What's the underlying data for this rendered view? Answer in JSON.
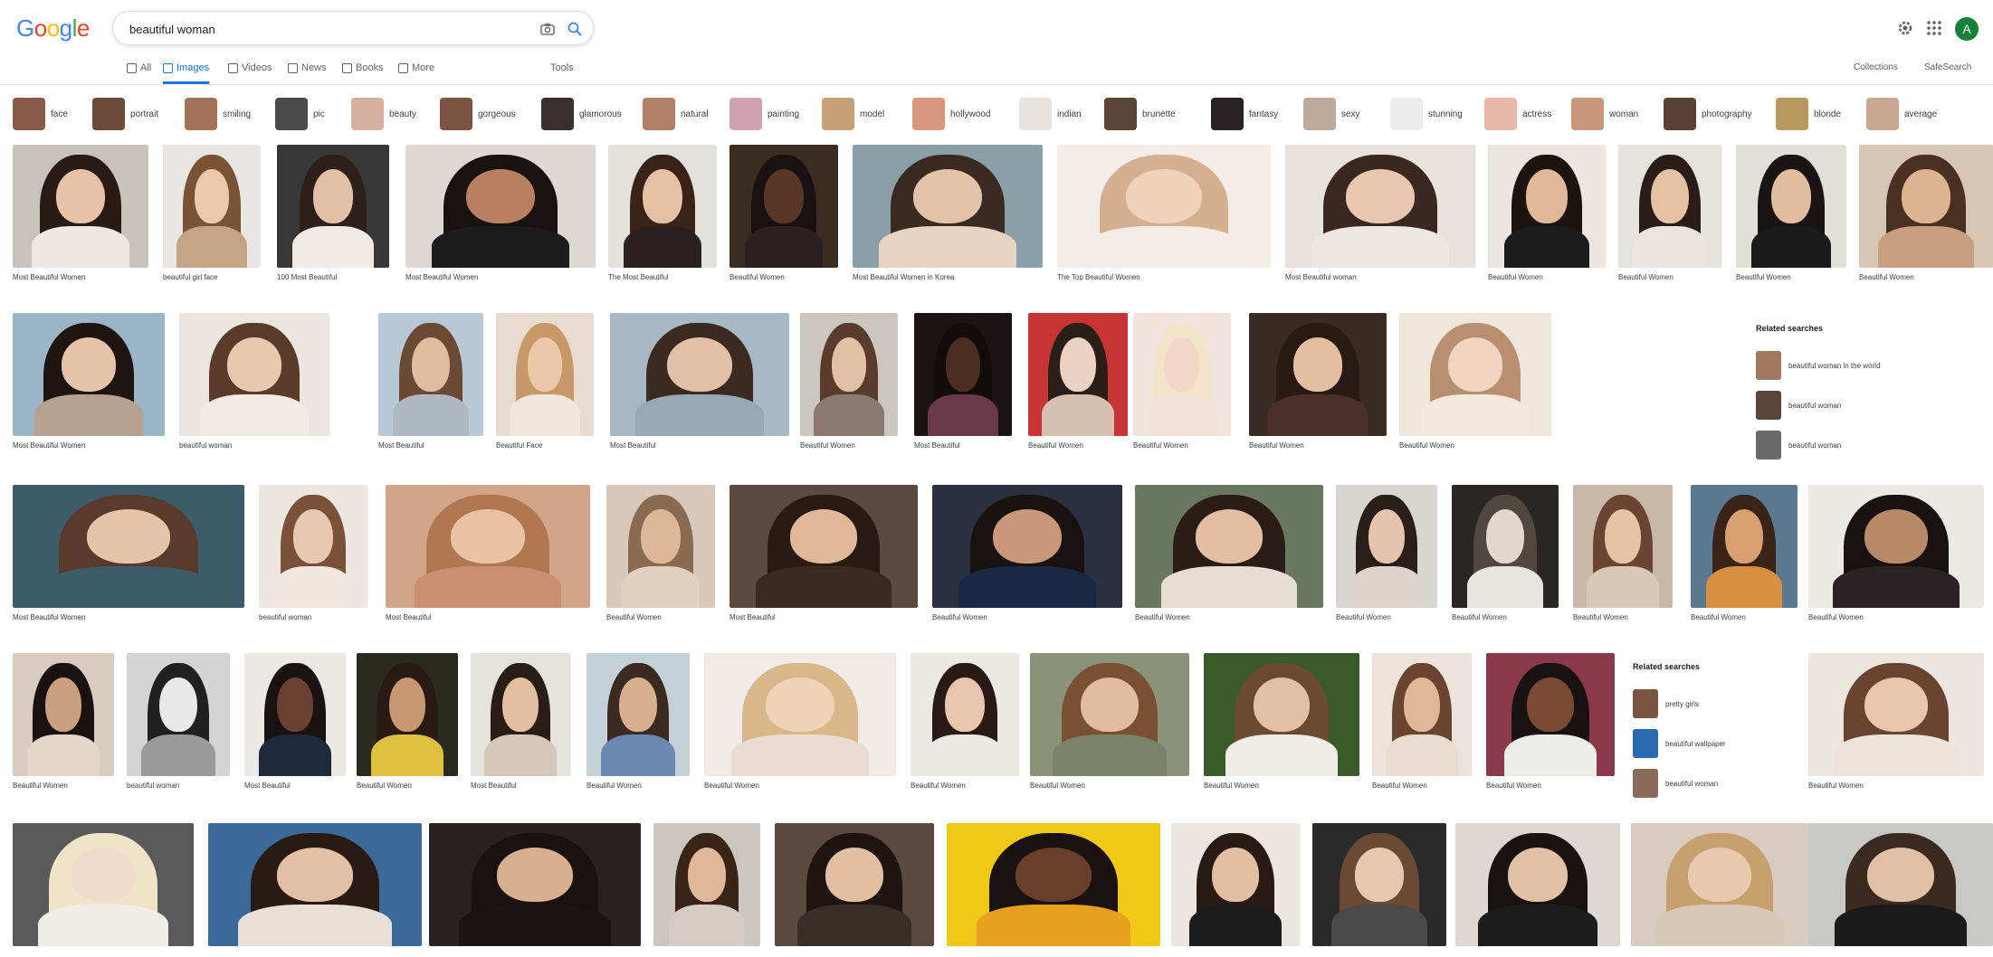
{
  "header": {
    "logo": [
      "G",
      "o",
      "o",
      "g",
      "l",
      "e"
    ],
    "search_value": "beautiful woman",
    "search_placeholder": "Search",
    "avatar_letter": "A",
    "icons": [
      "camera-icon",
      "search-icon",
      "settings-icon",
      "apps-icon"
    ]
  },
  "tabs": [
    {
      "label": "All",
      "icon": "search-icon",
      "active": false
    },
    {
      "label": "Images",
      "icon": "image-icon",
      "active": true
    },
    {
      "label": "Videos",
      "icon": "video-icon",
      "active": false
    },
    {
      "label": "News",
      "icon": "news-icon",
      "active": false
    },
    {
      "label": "Books",
      "icon": "book-icon",
      "active": false
    },
    {
      "label": "More",
      "icon": "more-icon",
      "active": false
    }
  ],
  "tools_label": "Tools",
  "right_links": {
    "collections": "Collections",
    "safesearch": "SafeSearch"
  },
  "chips": [
    {
      "label": "face",
      "color": "#8a5a48"
    },
    {
      "label": "portrait",
      "color": "#6b4a3a"
    },
    {
      "label": "smiling",
      "color": "#a27258"
    },
    {
      "label": "pic",
      "color": "#4a4a4a"
    },
    {
      "label": "beauty",
      "color": "#d8b0a0"
    },
    {
      "label": "gorgeous",
      "color": "#7a5440"
    },
    {
      "label": "glamorous",
      "color": "#3a3030"
    },
    {
      "label": "natural",
      "color": "#b08068"
    },
    {
      "label": "painting",
      "color": "#d2a0b0"
    },
    {
      "label": "model",
      "color": "#c8a078"
    },
    {
      "label": "hollywood",
      "color": "#d89880"
    },
    {
      "label": "indian",
      "color": "#e8e2dc"
    },
    {
      "label": "brunette",
      "color": "#5a4438"
    },
    {
      "label": "fantasy",
      "color": "#2a2224"
    },
    {
      "label": "sexy",
      "color": "#c0a898"
    },
    {
      "label": "stunning",
      "color": "#ececec"
    },
    {
      "label": "actress",
      "color": "#e8b8a8"
    },
    {
      "label": "woman",
      "color": "#c89878"
    },
    {
      "label": "photography",
      "color": "#5a4036"
    },
    {
      "label": "blonde",
      "color": "#b89860"
    },
    {
      "label": "average",
      "color": "#c8a890"
    }
  ],
  "rows": [
    [
      {
        "title": "Most Beautiful Women",
        "source": "",
        "bg": "#c8c2bc",
        "skin": "#e6c2a8",
        "hair": "#2a1a14",
        "cloth": "#efe8e2"
      },
      {
        "title": "beautiful girl face",
        "source": "",
        "bg": "#e8e6e2",
        "skin": "#ecc8ac",
        "hair": "#7a5234",
        "cloth": "#c4a484"
      },
      {
        "title": "100 Most Beautiful",
        "source": "",
        "bg": "#383838",
        "skin": "#e2c0a6",
        "hair": "#2e2018",
        "cloth": "#f0eae4"
      },
      {
        "title": "Most Beautiful Women",
        "source": "",
        "bg": "#ded8d2",
        "skin": "#b88060",
        "hair": "#1a1210",
        "cloth": "#1c1c1c"
      },
      {
        "title": "The Most Beautiful",
        "source": "",
        "bg": "#e4e0dc",
        "skin": "#e4c0a4",
        "hair": "#3a2218",
        "cloth": "#2a2020"
      },
      {
        "title": "Beautiful Women",
        "source": "",
        "bg": "#3a2c20",
        "skin": "#5a3626",
        "hair": "#1a1210",
        "cloth": "#2a2020"
      },
      {
        "title": "Most Beautiful Women in Korea",
        "source": "",
        "bg": "#8aa0a8",
        "skin": "#e2c2a8",
        "hair": "#3a2a22",
        "cloth": "#e8d4c4"
      },
      {
        "title": "The Top Beautiful Women",
        "source": "",
        "bg": "#f4ece6",
        "skin": "#f0d2bc",
        "hair": "#d4b090",
        "cloth": "#f4ece6"
      },
      {
        "title": "Most Beautiful woman",
        "source": "",
        "bg": "#e8e2de",
        "skin": "#e8c6b0",
        "hair": "#3a2820",
        "cloth": "#eee6e0"
      },
      {
        "title": "Beautiful Women",
        "source": "",
        "bg": "#ece6e2",
        "skin": "#e0b898",
        "hair": "#1c1410",
        "cloth": "#1c1c1c"
      },
      {
        "title": "Beautiful Women",
        "source": "",
        "bg": "#e6e2de",
        "skin": "#e4c0a4",
        "hair": "#2a1c16",
        "cloth": "#ece4de"
      },
      {
        "title": "Beautiful Women",
        "source": "",
        "bg": "#e2ded8",
        "skin": "#e2bca0",
        "hair": "#1a1412",
        "cloth": "#1a1a1a"
      },
      {
        "title": "Beautiful Women",
        "source": "",
        "bg": "#d8c6b4",
        "skin": "#dcb490",
        "hair": "#4a3020",
        "cloth": "#c8a080"
      }
    ],
    [
      {
        "title": "Most Beautiful Women",
        "source": "",
        "bg": "#9ab6c8",
        "skin": "#e6c4aa",
        "hair": "#1e1410",
        "cloth": "#b8a090"
      },
      {
        "title": "beautiful woman",
        "source": "",
        "bg": "#ece6e0",
        "skin": "#e8c8ae",
        "hair": "#5a3a28",
        "cloth": "#f0ebe6"
      },
      {
        "title": "Most Beautiful",
        "source": "",
        "bg": "#b8c8d4",
        "skin": "#e0bca0",
        "hair": "#6a4a34",
        "cloth": "#b0b8c0"
      },
      {
        "title": "Beautiful Face",
        "source": "",
        "bg": "#e8dcd0",
        "skin": "#ecc8aa",
        "hair": "#c89868",
        "cloth": "#f0e6dc"
      },
      {
        "title": "Most Beautiful",
        "source": "",
        "bg": "#a8b8c4",
        "skin": "#e2c0a6",
        "hair": "#3a2a20",
        "cloth": "#98a8b4"
      },
      {
        "title": "Beautiful Women",
        "source": "",
        "bg": "#ccc6c0",
        "skin": "#e2c0a6",
        "hair": "#5a3c2c",
        "cloth": "#8a7a70"
      },
      {
        "title": "Most Beautiful",
        "source": "",
        "bg": "#1a1414",
        "skin": "#4a2e22",
        "hair": "#120c0a",
        "cloth": "#6a3a4a"
      },
      {
        "title": "Beautiful Women",
        "source": "",
        "bg": "#c83434",
        "skin": "#ecd2c0",
        "hair": "#2a1e18",
        "cloth": "#d8c0b0"
      },
      {
        "title": "Beautiful Women",
        "source": "",
        "bg": "#f0e4dc",
        "skin": "#f2d6c6",
        "hair": "#f2e4c8",
        "cloth": "#f0e2d8"
      },
      {
        "title": "Beautiful Women",
        "source": "",
        "bg": "#3a2a24",
        "skin": "#e2bea2",
        "hair": "#2a1a14",
        "cloth": "#4a3028"
      },
      {
        "title": "Beautiful Women",
        "source": "",
        "bg": "#efe6dc",
        "skin": "#f0d4c0",
        "hair": "#b89070",
        "cloth": "#f2e8de"
      }
    ],
    [
      {
        "title": "Most Beautiful Women",
        "source": "",
        "bg": "#3c5c6c",
        "skin": "#e6c4aa",
        "hair": "#5a3a2a",
        "cloth": "#3c5c6c"
      },
      {
        "title": "beautiful woman",
        "source": "",
        "bg": "#ece6e0",
        "skin": "#e8c8b0",
        "hair": "#7a5038",
        "cloth": "#f0e8e0"
      },
      {
        "title": "Most Beautiful",
        "source": "",
        "bg": "#d2a48a",
        "skin": "#eac2a4",
        "hair": "#b07850",
        "cloth": "#c89070"
      },
      {
        "title": "Beautiful Women",
        "source": "",
        "bg": "#d8c8bc",
        "skin": "#dcb898",
        "hair": "#8a6a50",
        "cloth": "#e0d0c0"
      },
      {
        "title": "Most Beautiful",
        "source": "",
        "bg": "#5a4a40",
        "skin": "#e0b898",
        "hair": "#2a1a14",
        "cloth": "#3a2a22"
      },
      {
        "title": "Beautiful Women",
        "source": "",
        "bg": "#2a3040",
        "skin": "#c89878",
        "hair": "#1a1210",
        "cloth": "#1a2844"
      },
      {
        "title": "Beautiful Women",
        "source": "",
        "bg": "#6a7860",
        "skin": "#e2bea2",
        "hair": "#2a1c16",
        "cloth": "#e8ddd4"
      },
      {
        "title": "Beautiful Women",
        "source": "",
        "bg": "#d8d4d0",
        "skin": "#e4c4ac",
        "hair": "#2a1e18",
        "cloth": "#dcd4cc"
      },
      {
        "title": "Beautiful Women",
        "source": "",
        "bg": "#2a2624",
        "skin": "#e0d8d0",
        "hair": "#504840",
        "cloth": "#e8e4e0"
      },
      {
        "title": "Beautiful Women",
        "source": "",
        "bg": "#c8b8a8",
        "skin": "#e6c2a6",
        "hair": "#6a4630",
        "cloth": "#d8c8b8"
      },
      {
        "title": "Beautiful Women",
        "source": "",
        "bg": "#5a7890",
        "skin": "#d8a070",
        "hair": "#3a2418",
        "cloth": "#d89040"
      },
      {
        "title": "Beautiful Women",
        "source": "",
        "bg": "#ece8e4",
        "skin": "#b88a68",
        "hair": "#1a1210",
        "cloth": "#2a2224"
      }
    ],
    [
      {
        "title": "Beautiful Women",
        "source": "",
        "bg": "#d8ccc0",
        "skin": "#caa080",
        "hair": "#1a1210",
        "cloth": "#e4d6c8"
      },
      {
        "title": "beautiful woman",
        "source": "",
        "bg": "#d4d4d4",
        "skin": "#e8e8e8",
        "hair": "#202020",
        "cloth": "#9a9a9a"
      },
      {
        "title": "Most Beautiful",
        "source": "",
        "bg": "#ece8e4",
        "skin": "#6a4030",
        "hair": "#1a1210",
        "cloth": "#1c2a3c"
      },
      {
        "title": "Beautiful Women",
        "source": "",
        "bg": "#2a2a20",
        "skin": "#c89870",
        "hair": "#2a1a14",
        "cloth": "#e0c040"
      },
      {
        "title": "Most Beautiful",
        "source": "",
        "bg": "#e6e2de",
        "skin": "#e2bea2",
        "hair": "#2a1c16",
        "cloth": "#d8c8bc"
      },
      {
        "title": "Beautiful Women",
        "source": "",
        "bg": "#c4d0d8",
        "skin": "#d8b090",
        "hair": "#3a2a20",
        "cloth": "#6a88b0"
      },
      {
        "title": "Beautiful Women",
        "source": "",
        "bg": "#f0ebe6",
        "skin": "#efd2b8",
        "hair": "#d8b888",
        "cloth": "#e8dcd0"
      },
      {
        "title": "Beautiful Women",
        "source": "",
        "bg": "#ece8e4",
        "skin": "#e8c6ae",
        "hair": "#2a1a14",
        "cloth": "#ece8e4"
      },
      {
        "title": "Beautiful Women",
        "source": "",
        "bg": "#8a9278",
        "skin": "#e0bca0",
        "hair": "#7a5034",
        "cloth": "#7a8268"
      },
      {
        "title": "Beautiful Women",
        "source": "",
        "bg": "#3a5a2a",
        "skin": "#e2c0a6",
        "hair": "#6a4a30",
        "cloth": "#f0ece8"
      },
      {
        "title": "Beautiful Women",
        "source": "",
        "bg": "#ece4dc",
        "skin": "#e0b898",
        "hair": "#6a4630",
        "cloth": "#e8dcd0"
      },
      {
        "title": "Beautiful Women",
        "source": "",
        "bg": "#8a3a4a",
        "skin": "#7a4a34",
        "hair": "#1a1210",
        "cloth": "#ecece8"
      },
      {
        "title": "Beautiful Women",
        "source": "",
        "bg": "#ece6e0",
        "skin": "#e8c6ae",
        "hair": "#6a4430",
        "cloth": "#ece4dc"
      }
    ],
    [
      {
        "title": "",
        "source": "",
        "bg": "#5a5a5a",
        "skin": "#f0dccc",
        "hair": "#f0e4c8",
        "cloth": "#f0ece8"
      },
      {
        "title": "",
        "source": "",
        "bg": "#3a6a9a",
        "skin": "#e2c0a6",
        "hair": "#2a1a14",
        "cloth": "#e8e0d8"
      },
      {
        "title": "",
        "source": "",
        "bg": "#2a2220",
        "skin": "#d8b090",
        "hair": "#1a1210",
        "cloth": "#1a1414"
      },
      {
        "title": "",
        "source": "",
        "bg": "#ccc6c0",
        "skin": "#e0b898",
        "hair": "#3a2418",
        "cloth": "#d4ccc4"
      },
      {
        "title": "",
        "source": "",
        "bg": "#5a4a40",
        "skin": "#e2bea2",
        "hair": "#1e1410",
        "cloth": "#3a2e28"
      },
      {
        "title": "",
        "source": "",
        "bg": "#f0c818",
        "skin": "#6a3e2a",
        "hair": "#1a1210",
        "cloth": "#e8a020"
      },
      {
        "title": "",
        "source": "",
        "bg": "#ece6e0",
        "skin": "#e2bea2",
        "hair": "#2a1a14",
        "cloth": "#1c1c1c"
      },
      {
        "title": "",
        "source": "",
        "bg": "#2a2a2a",
        "skin": "#e6c8b0",
        "hair": "#6a4a34",
        "cloth": "#4a4a4a"
      },
      {
        "title": "",
        "source": "",
        "bg": "#ddd8d4",
        "skin": "#e2c0a6",
        "hair": "#1a1210",
        "cloth": "#1c1c1c"
      },
      {
        "title": "",
        "source": "",
        "bg": "#d8ccc0",
        "skin": "#e8c8ae",
        "hair": "#c8a070",
        "cloth": "#d8c8b8"
      },
      {
        "title": "",
        "source": "",
        "bg": "#c8c8c4",
        "skin": "#e2c0a6",
        "hair": "#3a2a20",
        "cloth": "#1a1a1a"
      }
    ]
  ],
  "related_panel_1": {
    "title": "Related searches",
    "items": [
      {
        "text": "beautiful woman in the world",
        "color": "#a07860"
      },
      {
        "text": "beautiful woman",
        "color": "#5a4438"
      },
      {
        "text": "beautiful woman",
        "color": "#6a6a6a"
      }
    ]
  },
  "related_panel_2": {
    "title": "Related searches",
    "items": [
      {
        "text": "pretty girls",
        "color": "#7a5440"
      },
      {
        "text": "beautiful wallpaper",
        "color": "#2a6ab0"
      },
      {
        "text": "beautiful woman",
        "color": "#8a6a58"
      }
    ]
  },
  "colors": {
    "accent": "#1a73e8",
    "caption": "#3c4043",
    "muted": "#80868b"
  }
}
